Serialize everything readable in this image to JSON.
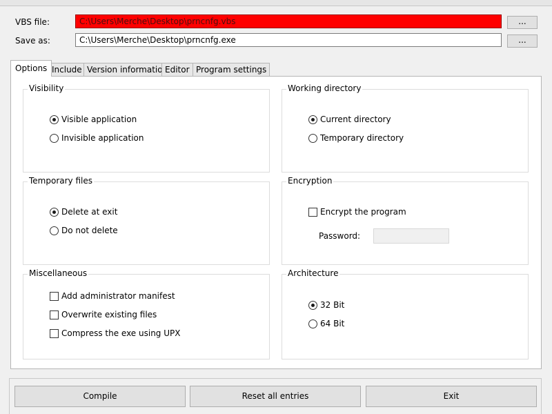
{
  "file_section": {
    "vbs_label": "VBS file:",
    "vbs_value": "C:\\Users\\Merche\\Desktop\\prncnfg.vbs",
    "save_label": "Save as:",
    "save_value": "C:\\Users\\Merche\\Desktop\\prncnfg.exe",
    "browse_label": "...",
    "error_color": "#ff0000"
  },
  "tabs": [
    {
      "label": "Options",
      "active": true
    },
    {
      "label": "Include"
    },
    {
      "label": "Version information"
    },
    {
      "label": "Editor"
    },
    {
      "label": "Program settings"
    }
  ],
  "visibility": {
    "title": "Visibility",
    "options": [
      {
        "label": "Visible application",
        "checked": true
      },
      {
        "label": "Invisible application",
        "checked": false
      }
    ]
  },
  "working_directory": {
    "title": "Working directory",
    "options": [
      {
        "label": "Current directory",
        "checked": true
      },
      {
        "label": "Temporary directory",
        "checked": false
      }
    ]
  },
  "temporary_files": {
    "title": "Temporary files",
    "options": [
      {
        "label": "Delete at exit",
        "checked": true
      },
      {
        "label": "Do not delete",
        "checked": false
      }
    ]
  },
  "encryption": {
    "title": "Encryption",
    "encrypt_label": "Encrypt the program",
    "encrypt_checked": false,
    "password_label": "Password:"
  },
  "miscellaneous": {
    "title": "Miscellaneous",
    "options": [
      {
        "label": "Add administrator manifest",
        "checked": false
      },
      {
        "label": "Overwrite existing files",
        "checked": false
      },
      {
        "label": "Compress the exe using UPX",
        "checked": false
      }
    ]
  },
  "architecture": {
    "title": "Architecture",
    "options": [
      {
        "label": "32 Bit",
        "checked": true
      },
      {
        "label": "64 Bit",
        "checked": false
      }
    ]
  },
  "buttons": {
    "compile": "Compile",
    "reset": "Reset all entries",
    "exit": "Exit"
  }
}
